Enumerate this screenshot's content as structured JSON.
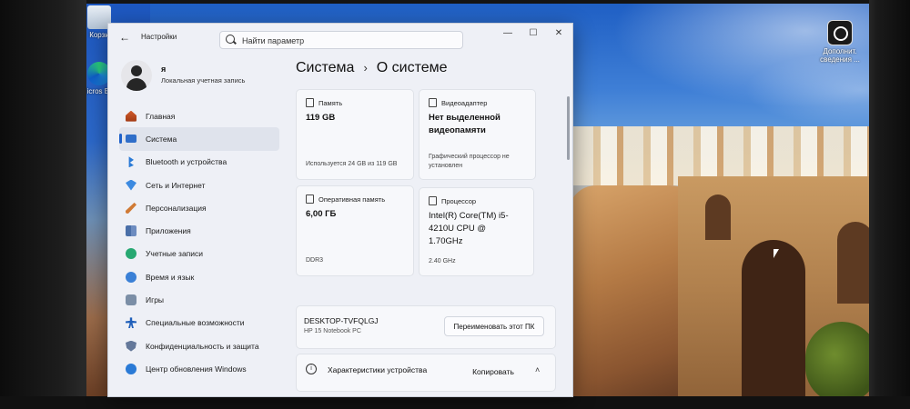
{
  "desktop": {
    "icons": [
      {
        "label": "Корзи",
        "icon": "recycle-bin-icon"
      },
      {
        "label": "Micros Edg",
        "icon": "edge-icon"
      },
      {
        "label": "Дополнит. сведения ...",
        "icon": "system-info-icon"
      }
    ]
  },
  "window": {
    "app_title": "Настройки",
    "back_icon": "←",
    "search_placeholder": "Найти параметр",
    "controls": {
      "minimize": "—",
      "maximize": "☐",
      "close": "✕"
    }
  },
  "profile": {
    "name": "я",
    "account_type": "Локальная учетная запись"
  },
  "sidebar": {
    "items": [
      {
        "label": "Главная",
        "icon": "home-icon",
        "active": false
      },
      {
        "label": "Система",
        "icon": "system-icon",
        "active": true
      },
      {
        "label": "Bluetooth и устройства",
        "icon": "bluetooth-icon",
        "active": false
      },
      {
        "label": "Сеть и Интернет",
        "icon": "network-icon",
        "active": false
      },
      {
        "label": "Персонализация",
        "icon": "personalization-icon",
        "active": false
      },
      {
        "label": "Приложения",
        "icon": "apps-icon",
        "active": false
      },
      {
        "label": "Учетные записи",
        "icon": "accounts-icon",
        "active": false
      },
      {
        "label": "Время и язык",
        "icon": "time-language-icon",
        "active": false
      },
      {
        "label": "Игры",
        "icon": "games-icon",
        "active": false
      },
      {
        "label": "Специальные возможности",
        "icon": "accessibility-icon",
        "active": false
      },
      {
        "label": "Конфиденциальность и защита",
        "icon": "privacy-shield-icon",
        "active": false
      },
      {
        "label": "Центр обновления Windows",
        "icon": "windows-update-icon",
        "active": false
      }
    ]
  },
  "breadcrumb": {
    "parent": "Система",
    "separator": "›",
    "current": "О системе"
  },
  "cards": {
    "storage": {
      "title": "Память",
      "value": "119 GB",
      "footer": "Используется 24 GB из 119 GB"
    },
    "gpu": {
      "title": "Видеоадаптер",
      "value": "Нет выделенной видеопамяти",
      "footer": "Графический процессор не установлен"
    },
    "ram": {
      "title": "Оперативная память",
      "value": "6,00 ГБ",
      "footer": "DDR3"
    },
    "cpu": {
      "title": "Процессор",
      "value": "Intel(R) Core(TM) i5-4210U CPU @ 1.70GHz",
      "footer": "2.40 GHz"
    }
  },
  "device": {
    "name": "DESKTOP-TVFQLGJ",
    "model": "HP 15 Notebook PC",
    "rename_label": "Переименовать этот ПК"
  },
  "specs": {
    "label": "Характеристики устройства",
    "copy_label": "Копировать",
    "info_glyph": "i",
    "chevron": "˄"
  }
}
